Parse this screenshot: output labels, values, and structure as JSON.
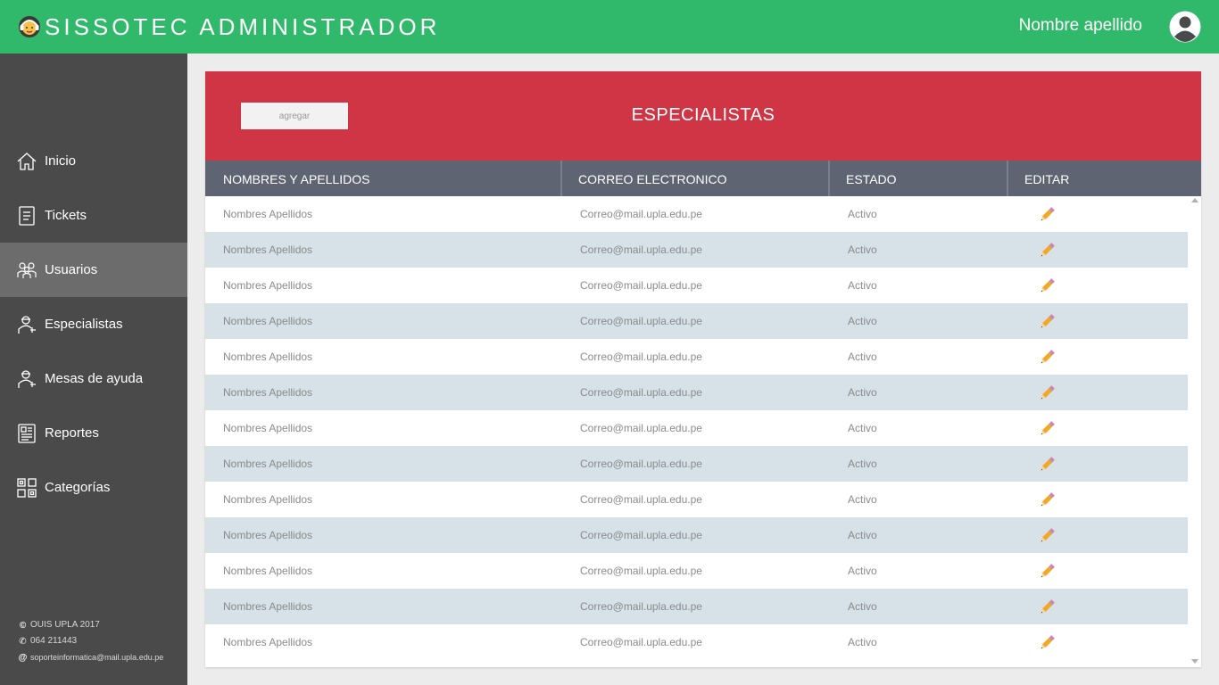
{
  "header": {
    "brand": "SISSOTEC ADMINISTRADOR",
    "logo_icon": "support-agent-icon",
    "user_name": "Nombre apellido",
    "avatar_icon": "user-avatar-icon",
    "bg_color": "#30b96a"
  },
  "sidebar": {
    "items": [
      {
        "label": "Inicio",
        "icon": "home-icon"
      },
      {
        "label": "Tickets",
        "icon": "ticket-icon"
      },
      {
        "label": "Usuarios",
        "icon": "users-icon",
        "active": true
      },
      {
        "label": "Especialistas",
        "icon": "specialist-icon"
      },
      {
        "label": "Mesas de ayuda",
        "icon": "helpdesk-icon"
      },
      {
        "label": "Reportes",
        "icon": "reports-icon"
      },
      {
        "label": "Categorías",
        "icon": "categories-icon"
      }
    ],
    "footer": {
      "copyright": "OUIS UPLA 2017",
      "phone": "064 211443",
      "email": "soporteinformatica@mail.upla.edu.pe"
    }
  },
  "panel": {
    "add_label": "agregar",
    "title": "ESPECIALISTAS",
    "header_color": "#cf3545",
    "columns": [
      "NOMBRES Y APELLIDOS",
      "CORREO ELECTRONICO",
      "ESTADO",
      "EDITAR"
    ],
    "rows": [
      {
        "name": "Nombres Apellidos",
        "email": "Correo@mail.upla.edu.pe",
        "status": "Activo"
      },
      {
        "name": "Nombres Apellidos",
        "email": "Correo@mail.upla.edu.pe",
        "status": "Activo"
      },
      {
        "name": "Nombres Apellidos",
        "email": "Correo@mail.upla.edu.pe",
        "status": "Activo"
      },
      {
        "name": "Nombres Apellidos",
        "email": "Correo@mail.upla.edu.pe",
        "status": "Activo"
      },
      {
        "name": "Nombres Apellidos",
        "email": "Correo@mail.upla.edu.pe",
        "status": "Activo"
      },
      {
        "name": "Nombres Apellidos",
        "email": "Correo@mail.upla.edu.pe",
        "status": "Activo"
      },
      {
        "name": "Nombres Apellidos",
        "email": "Correo@mail.upla.edu.pe",
        "status": "Activo"
      },
      {
        "name": "Nombres Apellidos",
        "email": "Correo@mail.upla.edu.pe",
        "status": "Activo"
      },
      {
        "name": "Nombres Apellidos",
        "email": "Correo@mail.upla.edu.pe",
        "status": "Activo"
      },
      {
        "name": "Nombres Apellidos",
        "email": "Correo@mail.upla.edu.pe",
        "status": "Activo"
      },
      {
        "name": "Nombres Apellidos",
        "email": "Correo@mail.upla.edu.pe",
        "status": "Activo"
      },
      {
        "name": "Nombres Apellidos",
        "email": "Correo@mail.upla.edu.pe",
        "status": "Activo"
      },
      {
        "name": "Nombres Apellidos",
        "email": "Correo@mail.upla.edu.pe",
        "status": "Activo"
      }
    ],
    "edit_icon": "pencil-icon"
  }
}
